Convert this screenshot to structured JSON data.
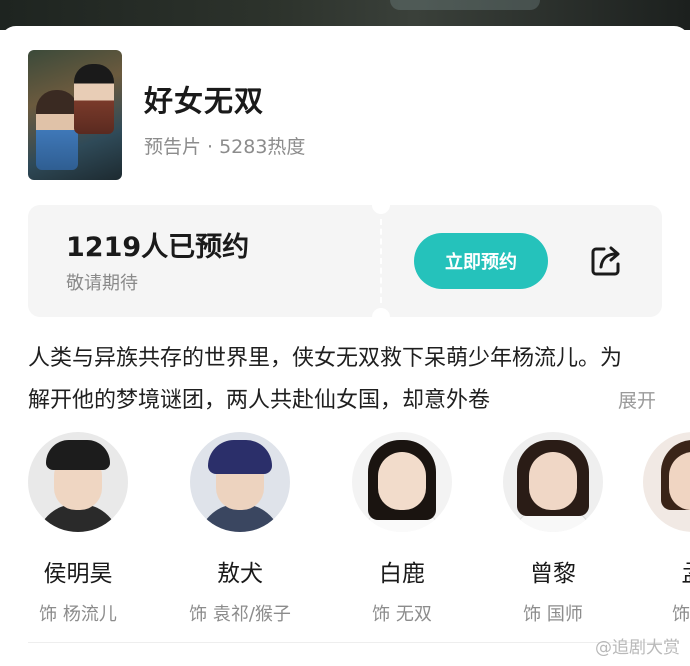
{
  "header": {
    "title": "好女无双",
    "type_label": "预告片",
    "separator": "·",
    "heat": "5283热度"
  },
  "reservation": {
    "count_text": "1219人已预约",
    "subtitle": "敬请期待",
    "button_label": "立即预约"
  },
  "description": {
    "text": "人类与异族共存的世界里，侠女无双救下呆萌少年杨流儿。为解开他的梦境谜团，两人共赴仙女国，却意外卷",
    "expand_label": "展开"
  },
  "cast": [
    {
      "name": "侯明昊",
      "role": "饰 杨流儿"
    },
    {
      "name": "敖犬",
      "role": "饰 袁祁/猴子"
    },
    {
      "name": "白鹿",
      "role": "饰 无双"
    },
    {
      "name": "曾黎",
      "role": "饰 国师"
    },
    {
      "name": "孟",
      "role": "饰 王"
    }
  ],
  "watermark": "@追剧大赏",
  "colors": {
    "accent": "#25c2bb",
    "text_primary": "#1a1a1a",
    "text_secondary": "#8c8c8c",
    "ticket_bg": "#f5f5f5"
  },
  "icons": {
    "share": "share-icon",
    "poster": "poster-image"
  }
}
